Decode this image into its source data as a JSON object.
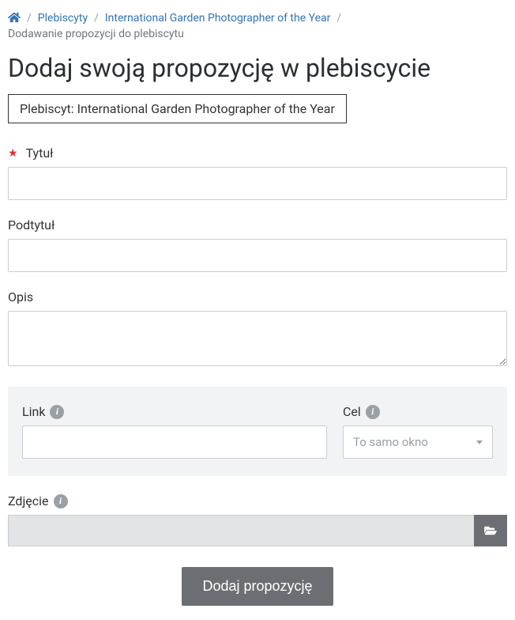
{
  "breadcrumb": {
    "plebiscyty": "Plebiscyty",
    "contest": "International Garden Photographer of the Year",
    "current": "Dodawanie propozycji do plebiscytu"
  },
  "page_title": "Dodaj swoją propozycję w plebiscycie",
  "badge": "Plebiscyt: International Garden Photographer of the Year",
  "fields": {
    "title_label": "Tytuł",
    "subtitle_label": "Podtytuł",
    "description_label": "Opis",
    "link_label": "Link",
    "target_label": "Cel",
    "target_selected": "To samo okno",
    "image_label": "Zdjęcie"
  },
  "submit_label": "Dodaj propozycję",
  "values": {
    "title": "",
    "subtitle": "",
    "description": "",
    "link": "",
    "image": ""
  }
}
